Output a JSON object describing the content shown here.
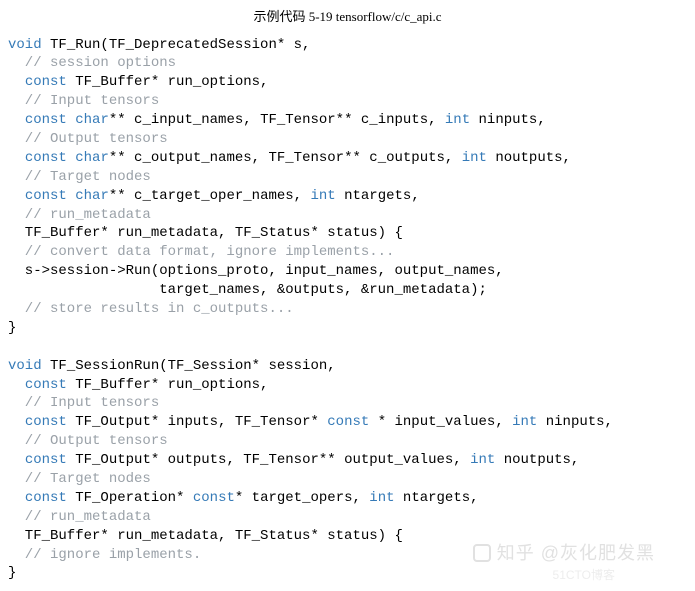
{
  "title": "示例代码 5-19  tensorflow/c/c_api.c",
  "fn1": {
    "l1_kw1": "void",
    "l1_rest": " TF_Run(TF_DeprecatedSession* s,",
    "c1": "  // session options",
    "l2a": "  ",
    "l2_kw": "const",
    "l2b": " TF_Buffer* run_options,",
    "c2": "  // Input tensors",
    "l3a": "  ",
    "l3_kw1": "const",
    "l3b": " ",
    "l3_kw2": "char",
    "l3c": "** c_input_names, TF_Tensor** c_inputs, ",
    "l3_kw3": "int",
    "l3d": " ninputs,",
    "c3": "  // Output tensors",
    "l4a": "  ",
    "l4_kw1": "const",
    "l4b": " ",
    "l4_kw2": "char",
    "l4c": "** c_output_names, TF_Tensor** c_outputs, ",
    "l4_kw3": "int",
    "l4d": " noutputs,",
    "c4": "  // Target nodes",
    "l5a": "  ",
    "l5_kw1": "const",
    "l5b": " ",
    "l5_kw2": "char",
    "l5c": "** c_target_oper_names, ",
    "l5_kw3": "int",
    "l5d": " ntargets,",
    "c5": "  // run_metadata",
    "l6": "  TF_Buffer* run_metadata, TF_Status* status) {",
    "c6": "  // convert data format, ignore implements...",
    "l7": "  s->session->Run(options_proto, input_names, output_names,",
    "l8": "                  target_names, &outputs, &run_metadata);",
    "c7": "  // store results in c_outputs...",
    "l9": "}"
  },
  "fn2": {
    "l1_kw1": "void",
    "l1_rest": " TF_SessionRun(TF_Session* session,",
    "l2a": "  ",
    "l2_kw": "const",
    "l2b": " TF_Buffer* run_options,",
    "c1": "  // Input tensors",
    "l3a": "  ",
    "l3_kw1": "const",
    "l3b": " TF_Output* inputs, TF_Tensor* ",
    "l3_kw2": "const",
    "l3c": " * input_values, ",
    "l3_kw3": "int",
    "l3d": " ninputs,",
    "c2": "  // Output tensors",
    "l4a": "  ",
    "l4_kw1": "const",
    "l4b": " TF_Output* outputs, TF_Tensor** output_values, ",
    "l4_kw2": "int",
    "l4c": " noutputs,",
    "c3": "  // Target nodes",
    "l5a": "  ",
    "l5_kw1": "const",
    "l5b": " TF_Operation* ",
    "l5_kw2": "const",
    "l5c": "* target_opers, ",
    "l5_kw3": "int",
    "l5d": " ntargets,",
    "c4": "  // run_metadata",
    "l6": "  TF_Buffer* run_metadata, TF_Status* status) {",
    "c5": "  // ignore implements.",
    "l7": "}"
  },
  "watermark": "知乎 @灰化肥发黑",
  "watermark2": "51CTO博客"
}
